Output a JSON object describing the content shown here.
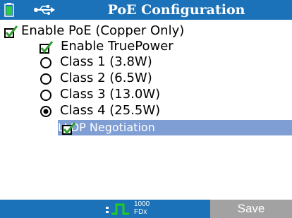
{
  "header": {
    "title": "PoE Configuration",
    "battery_icon": "battery-icon",
    "usb_icon": "usb-icon"
  },
  "options": {
    "enable_poe": {
      "label": "Enable PoE (Copper Only)",
      "checked": true
    },
    "enable_truepower": {
      "label": "Enable TruePower",
      "checked": true
    },
    "classes": [
      {
        "label": "Class 1 (3.8W)",
        "selected": false
      },
      {
        "label": "Class 2 (6.5W)",
        "selected": false
      },
      {
        "label": "Class 3 (13.0W)",
        "selected": false
      },
      {
        "label": "Class 4 (25.5W)",
        "selected": true
      }
    ],
    "lldp": {
      "label": "LLDP Negotiation",
      "checked": true,
      "highlighted": true
    }
  },
  "footer": {
    "link_icon": "link-pulse-icon",
    "link_speed": "1000",
    "link_duplex": "FDx",
    "save_label": "Save"
  },
  "colors": {
    "title_bar": "#1b72b8",
    "selection_highlight": "#7f9ed4",
    "check_green": "#2f9e2f",
    "link_green": "#22cc22",
    "save_button": "#a2a2a2"
  }
}
